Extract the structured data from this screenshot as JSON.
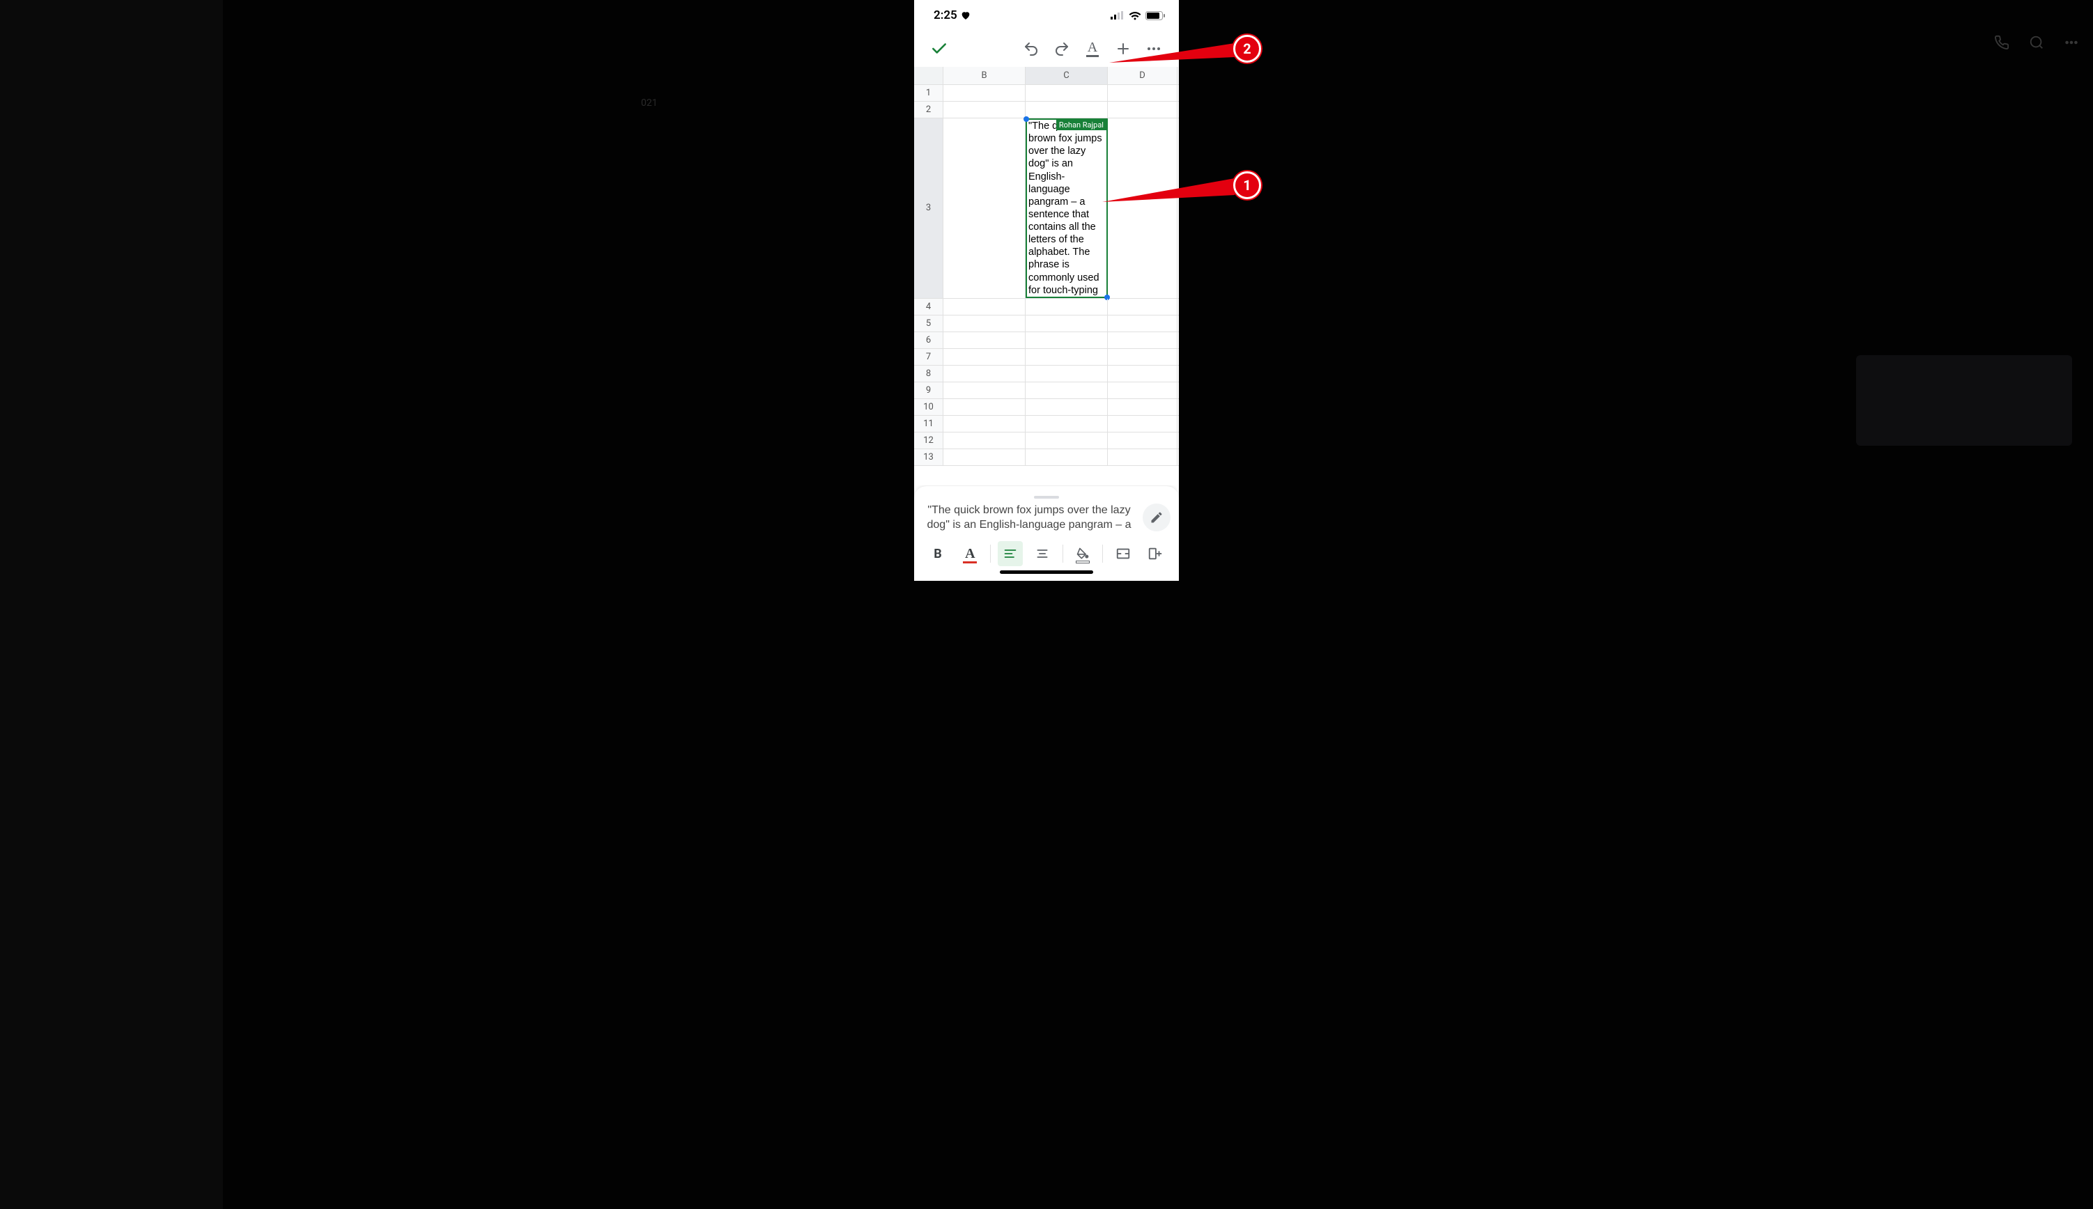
{
  "status": {
    "time": "2:25",
    "heart_icon": "heart"
  },
  "toolbar": {
    "confirm": "✓",
    "undo": "undo",
    "redo": "redo",
    "text_format": "A",
    "insert": "+",
    "more": "⋯"
  },
  "columns": [
    "B",
    "C",
    "D"
  ],
  "active_column": "C",
  "rows": [
    1,
    2,
    3,
    4,
    5,
    6,
    7,
    8,
    9,
    10,
    11,
    12,
    13
  ],
  "active_row": 3,
  "collab_user": "Rohan Rajpal",
  "cell_c3": "\"The quick brown fox jumps over the lazy dog\" is an English-language pangram – a sentence that contains all the letters of the alphabet. The phrase is commonly used for touch-typing",
  "formula_bar": "\"The quick brown fox jumps over the lazy dog\" is an English-language pangram – a",
  "format_buttons": {
    "bold": "B",
    "textcolor": "A",
    "align_left": "align-left",
    "align_center": "align-center",
    "fill": "fill",
    "insert_cells": "cells",
    "insert_column": "column"
  },
  "callouts": {
    "c1": "1",
    "c2": "2"
  },
  "bg_year": "021"
}
